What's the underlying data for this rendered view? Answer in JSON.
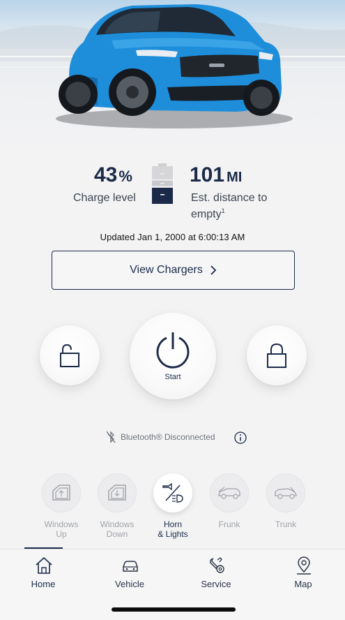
{
  "vehicle": {
    "image_name": "vehicle-photo",
    "color": "#1f8fde"
  },
  "charge": {
    "percent_value": "43",
    "percent_unit": "%",
    "percent_label": "Charge level",
    "level_fraction": 0.43,
    "range_value": "101",
    "range_unit": "MI",
    "range_label_line1": "Est. distance to",
    "range_label_line2": "empty",
    "range_footnote": "1"
  },
  "updated_text": "Updated Jan 1, 2000 at 6:00:13 AM",
  "chargers_button": {
    "label": "View Chargers",
    "icon": "chevron-right-icon"
  },
  "controls": {
    "unlock": {
      "icon": "unlock-icon"
    },
    "start": {
      "label": "Start",
      "icon": "power-icon"
    },
    "lock": {
      "icon": "lock-icon"
    }
  },
  "bluetooth": {
    "status": "Bluetooth® Disconnected",
    "icon": "bluetooth-off-icon",
    "info_icon": "info-icon"
  },
  "quick_actions": [
    {
      "line1": "Windows",
      "line2": "Up",
      "icon": "window-up-icon",
      "active": false
    },
    {
      "line1": "Windows",
      "line2": "Down",
      "icon": "window-down-icon",
      "active": false
    },
    {
      "line1": "Horn",
      "line2": "& Lights",
      "icon": "horn-lights-icon",
      "active": true
    },
    {
      "line1": "Frunk",
      "line2": "",
      "icon": "frunk-icon",
      "active": false
    },
    {
      "line1": "Trunk",
      "line2": "",
      "icon": "trunk-icon",
      "active": false
    }
  ],
  "nav": [
    {
      "label": "Home",
      "icon": "home-icon",
      "selected": true
    },
    {
      "label": "Vehicle",
      "icon": "car-icon",
      "selected": false
    },
    {
      "label": "Service",
      "icon": "service-icon",
      "selected": false
    },
    {
      "label": "Map",
      "icon": "map-pin-icon",
      "selected": false
    }
  ],
  "colors": {
    "navy": "#1b2a48",
    "background": "#f3f3f4",
    "muted": "#a0a3a8"
  }
}
